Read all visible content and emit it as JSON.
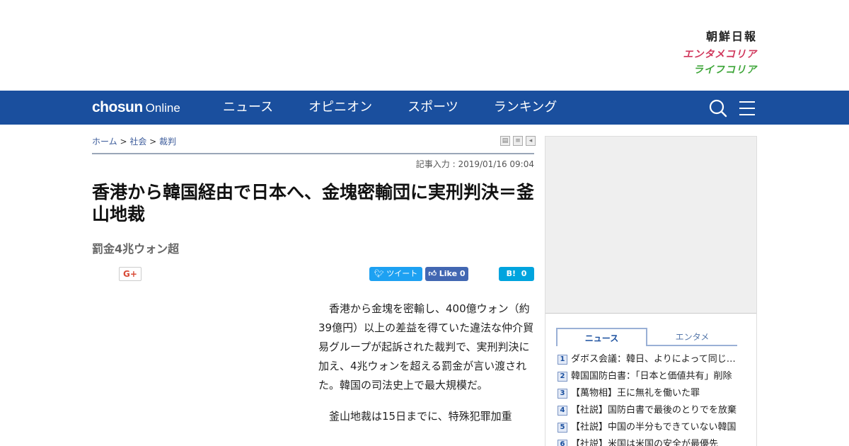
{
  "brands": {
    "chosun_ilbo": "朝鮮日報",
    "entame_korea": "エンタメコリア",
    "life_korea": "ライフコリア"
  },
  "nav": {
    "logo_bold": "chosun",
    "logo_light": "Online",
    "items": [
      {
        "label": "ニュース"
      },
      {
        "label": "オピニオン"
      },
      {
        "label": "スポーツ"
      },
      {
        "label": "ランキング"
      }
    ],
    "icons": [
      "search-icon",
      "menu-icon"
    ]
  },
  "breadcrumb": {
    "home": "ホーム",
    "sep": " > ",
    "category": "社会",
    "subcategory": "裁判"
  },
  "dateline": "記事入力 : 2019/01/16 09:04",
  "article": {
    "headline": "香港から韓国経由で日本へ、金塊密輸団に実刑判決＝釜山地裁",
    "subhead": "罰金4兆ウォン超",
    "paragraphs": [
      "香港から金塊を密輸し、400億ウォン（約39億円）以上の差益を得ていた違法な仲介貿易グループが起訴された裁判で、実刑判決に加え、4兆ウォンを超える罰金が言い渡された。韓国の司法史上で最大規模だ。",
      "釜山地裁は15日までに、特殊犯罪加重"
    ]
  },
  "social": {
    "gplus": "G+",
    "tweet": "ツイート",
    "like": "Like",
    "like_count": "0",
    "hatena": "B!",
    "hatena_count": "0"
  },
  "sidebar": {
    "tabs": [
      {
        "label": "ニュース",
        "active": true
      },
      {
        "label": "エンタメ",
        "active": false
      }
    ],
    "ranking": [
      {
        "rank": "1",
        "title": "ダボス会議：韓日、よりによって同じ日に"
      },
      {
        "rank": "2",
        "title": "韓国国防白書：「日本と価値共有」削除"
      },
      {
        "rank": "3",
        "title": "【萬物相】王に無礼を働いた罪"
      },
      {
        "rank": "4",
        "title": "【社説】国防白書で最後のとりでを放棄"
      },
      {
        "rank": "5",
        "title": "【社説】中国の半分もできていない韓国"
      },
      {
        "rank": "6",
        "title": "【社説】米国は米国の安全が最優先"
      }
    ]
  },
  "colors": {
    "nav_bg": "#1a4f9e",
    "entame": "#d0365b",
    "life": "#3fa63a",
    "twitter": "#1da1f2",
    "facebook": "#4267b2",
    "hatena": "#00a4de"
  }
}
